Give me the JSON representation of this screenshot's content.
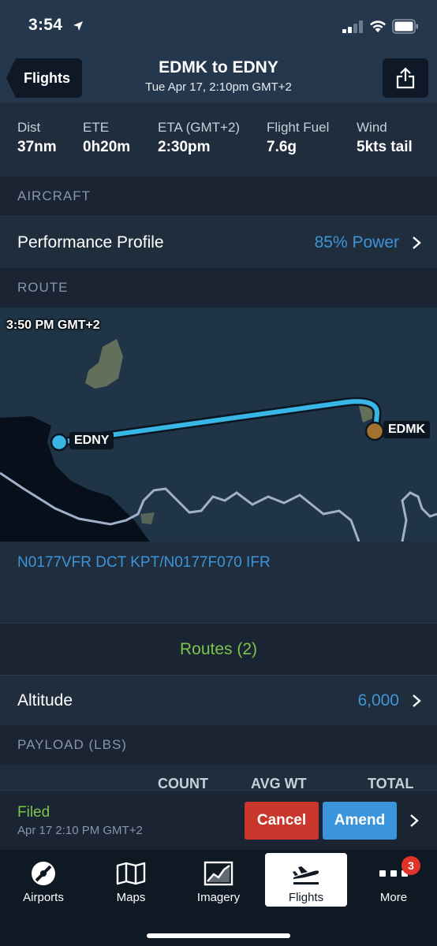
{
  "status_bar": {
    "time": "3:54"
  },
  "nav": {
    "back_label": "Flights",
    "title": "EDMK to EDNY",
    "subtitle": "Tue Apr 17, 2:10pm GMT+2"
  },
  "stats": [
    {
      "label": "Dist",
      "value": "37nm"
    },
    {
      "label": "ETE",
      "value": "0h20m"
    },
    {
      "label": "ETA (GMT+2)",
      "value": "2:30pm"
    },
    {
      "label": "Flight Fuel",
      "value": "7.6g"
    },
    {
      "label": "Wind",
      "value": "5kts tail"
    }
  ],
  "aircraft": {
    "header": "AIRCRAFT",
    "performance_label": "Performance Profile",
    "performance_value": "85% Power"
  },
  "route": {
    "header": "ROUTE",
    "map_time": "3:50 PM GMT+2",
    "departure": "EDMK",
    "destination": "EDNY",
    "route_string": "N0177VFR DCT KPT/N0177F070 IFR",
    "routes_link": "Routes (2)"
  },
  "altitude": {
    "label": "Altitude",
    "value": "6,000"
  },
  "payload": {
    "header": "PAYLOAD (LBS)",
    "columns": [
      "COUNT",
      "AVG WT",
      "TOTAL"
    ]
  },
  "filing": {
    "status": "Filed",
    "time": "Apr 17 2:10 PM GMT+2",
    "cancel_label": "Cancel",
    "amend_label": "Amend"
  },
  "tabs": [
    {
      "label": "Airports",
      "icon": "airport-icon"
    },
    {
      "label": "Maps",
      "icon": "map-icon"
    },
    {
      "label": "Imagery",
      "icon": "imagery-icon"
    },
    {
      "label": "Flights",
      "icon": "flights-icon",
      "active": true
    },
    {
      "label": "More",
      "icon": "more-icon",
      "badge": "3"
    }
  ],
  "colors": {
    "accent_blue": "#3d95d8",
    "green": "#7cc44a",
    "cancel_red": "#c9372c",
    "route_line": "#38b6e6"
  }
}
